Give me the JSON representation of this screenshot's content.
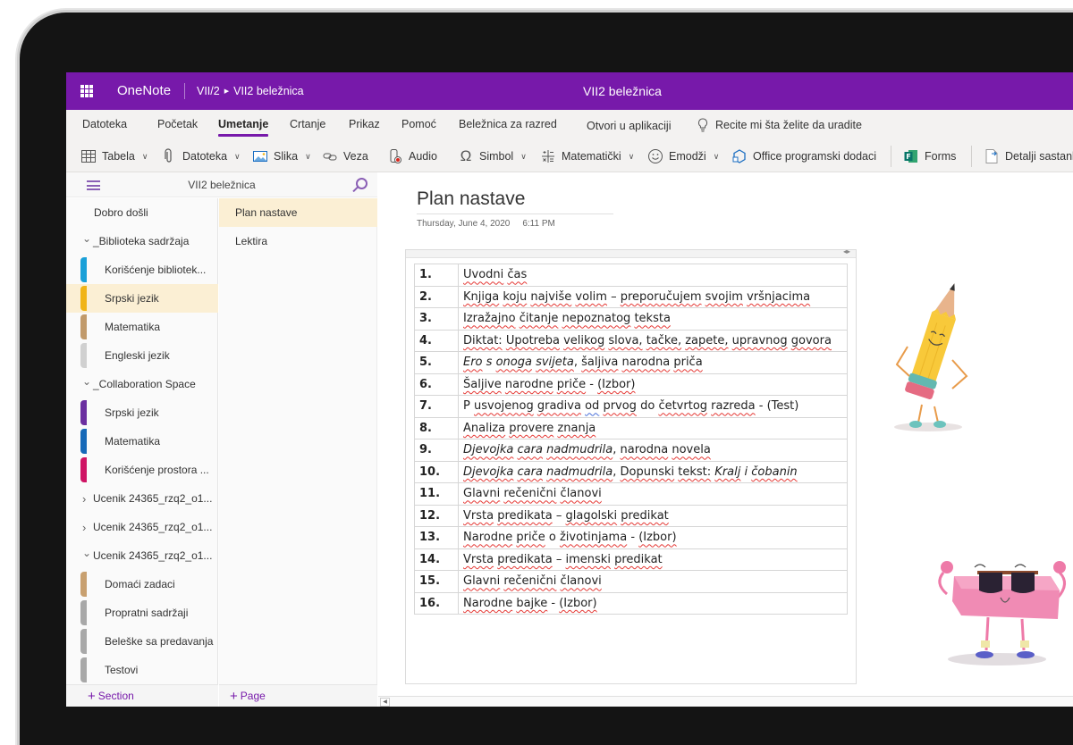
{
  "titlebar": {
    "app_name": "OneNote",
    "breadcrumb": [
      "VII/2",
      "VII2 beležnica"
    ],
    "document_title": "VII2 beležnica",
    "brand_color": "#7719aa"
  },
  "menu": {
    "tabs": [
      {
        "label": "Datoteka"
      },
      {
        "label": "Početak"
      },
      {
        "label": "Umetanje",
        "active": true
      },
      {
        "label": "Crtanje"
      },
      {
        "label": "Prikaz"
      },
      {
        "label": "Pomoć"
      },
      {
        "label": "Beležnica za razred"
      },
      {
        "label": "Otvori u aplikaciji"
      }
    ],
    "tell_me": "Recite mi šta želite da uradite"
  },
  "ribbon": {
    "items": [
      {
        "label": "Tabela",
        "icon": "table-icon",
        "dropdown": true
      },
      {
        "label": "Datoteka",
        "icon": "paperclip-icon",
        "dropdown": true
      },
      {
        "label": "Slika",
        "icon": "picture-icon",
        "dropdown": true
      },
      {
        "label": "Veza",
        "icon": "link-icon",
        "dropdown": false
      },
      {
        "label": "Audio",
        "icon": "audio-record-icon",
        "dropdown": false
      },
      {
        "label": "Simbol",
        "icon": "omega-icon",
        "dropdown": true
      },
      {
        "label": "Matematički",
        "icon": "math-icon",
        "dropdown": true
      },
      {
        "label": "Emodži",
        "icon": "emoji-icon",
        "dropdown": true
      },
      {
        "label": "Office programski dodaci",
        "icon": "office-addins-icon",
        "dropdown": false
      },
      {
        "label": "Forms",
        "icon": "forms-icon",
        "dropdown": false
      },
      {
        "label": "Detalji sastank",
        "icon": "meeting-details-icon",
        "dropdown": false
      }
    ]
  },
  "nav": {
    "notebook_title": "VII2 beležnica",
    "sections": [
      {
        "label": "Dobro došli",
        "kind": "top",
        "color": "#6b2fa0"
      },
      {
        "label": "_Biblioteka sadržaja",
        "kind": "group",
        "expanded": true
      },
      {
        "label": "Korišćenje bibliotek...",
        "kind": "sec",
        "color": "#1aa0d8"
      },
      {
        "label": "Srpski jezik",
        "kind": "sec",
        "color": "#f0b418",
        "selected": true
      },
      {
        "label": "Matematika",
        "kind": "sec",
        "color": "#c19a6b"
      },
      {
        "label": "Engleski jezik",
        "kind": "sec",
        "color": "#d0d0d0"
      },
      {
        "label": "_Collaboration Space",
        "kind": "group",
        "expanded": true
      },
      {
        "label": "Srpski jezik",
        "kind": "sec",
        "color": "#6b2fa0"
      },
      {
        "label": "Matematika",
        "kind": "sec",
        "color": "#1669b8"
      },
      {
        "label": "Korišćenje prostora ...",
        "kind": "sec",
        "color": "#cf1464"
      },
      {
        "label": "Ucenik 24365_rzq2_o1...",
        "kind": "group",
        "expanded": false
      },
      {
        "label": "Ucenik 24365_rzq2_o1...",
        "kind": "group",
        "expanded": false
      },
      {
        "label": "Ucenik 24365_rzq2_o1...",
        "kind": "group",
        "expanded": true
      },
      {
        "label": "Domaći zadaci",
        "kind": "sec",
        "color": "#c8a070"
      },
      {
        "label": "Propratni sadržaji",
        "kind": "sec",
        "color": "#a8a8a8"
      },
      {
        "label": "Beleške sa predavanja",
        "kind": "sec",
        "color": "#a8a8a8"
      },
      {
        "label": "Testovi",
        "kind": "sec",
        "color": "#a8a8a8"
      }
    ],
    "pages": [
      {
        "label": "Plan nastave",
        "selected": true
      },
      {
        "label": "Lektira"
      }
    ],
    "add_section": "Section",
    "add_page": "Page"
  },
  "page": {
    "title": "Plan nastave",
    "date": "Thursday, June 4, 2020",
    "time": "6:11 PM",
    "rows": [
      {
        "num": "1.",
        "parts": [
          {
            "t": "Uvodni čas"
          }
        ]
      },
      {
        "num": "2.",
        "parts": [
          {
            "t": "Knjiga koju najviše volim – preporučujem svojim vršnjacima"
          }
        ]
      },
      {
        "num": "3.",
        "parts": [
          {
            "t": "Izražajno čitanje nepoznatog teksta"
          }
        ]
      },
      {
        "num": "4.",
        "parts": [
          {
            "t": "Diktat: Upotreba velikog slova, tačke, zapete, upravnog govora"
          }
        ]
      },
      {
        "num": "5.",
        "parts": [
          {
            "t": "Ero s onoga svijeta",
            "i": true
          },
          {
            "t": ", šaljiva narodna priča"
          }
        ]
      },
      {
        "num": "6.",
        "parts": [
          {
            "t": "Šaljive narodne priče - (Izbor)"
          }
        ]
      },
      {
        "num": "7.",
        "parts": [
          {
            "t": "P usvojenog gradiva od prvog do četvrtog razreda - (Test)"
          }
        ]
      },
      {
        "num": "8.",
        "parts": [
          {
            "t": "Analiza provere znanja"
          }
        ]
      },
      {
        "num": "9.",
        "parts": [
          {
            "t": "Djevojka cara nadmudrila",
            "i": true
          },
          {
            "t": ", narodna novela"
          }
        ]
      },
      {
        "num": "10.",
        "parts": [
          {
            "t": "Djevojka cara nadmudrila",
            "i": true
          },
          {
            "t": ", Dopunski tekst: "
          },
          {
            "t": "Kralj i čobanin",
            "i": true
          }
        ]
      },
      {
        "num": "11.",
        "parts": [
          {
            "t": "Glavni rečenični članovi"
          }
        ]
      },
      {
        "num": "12.",
        "parts": [
          {
            "t": "Vrsta predikata – glagolski predikat"
          }
        ]
      },
      {
        "num": "13.",
        "parts": [
          {
            "t": "Narodne priče o životinjama - (Izbor)"
          }
        ]
      },
      {
        "num": "14.",
        "parts": [
          {
            "t": "Vrsta predikata – imenski predikat"
          }
        ]
      },
      {
        "num": "15.",
        "parts": [
          {
            "t": "Glavni rečenični članovi"
          }
        ]
      },
      {
        "num": "16.",
        "parts": [
          {
            "t": "Narodne bajke - (Izbor)"
          }
        ]
      }
    ],
    "illustrations": [
      "pencil-character",
      "eraser-character-with-sunglasses"
    ]
  }
}
